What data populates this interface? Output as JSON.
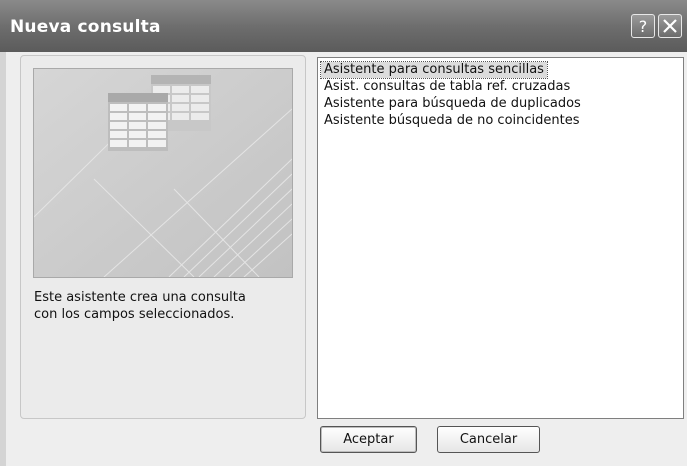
{
  "window": {
    "title": "Nueva consulta",
    "help_label": "?",
    "close_label": "X"
  },
  "preview": {
    "icon": "query-table-illustration-icon",
    "description_line1": "Este asistente crea una consulta",
    "description_line2": "con los campos seleccionados."
  },
  "wizard_list": {
    "items": [
      "Asistente para consultas sencillas",
      "Asist. consultas de tabla ref. cruzadas",
      "Asistente para búsqueda de duplicados",
      "Asistente búsqueda de no coincidentes"
    ],
    "selected_index": 0
  },
  "buttons": {
    "ok_label": "Aceptar",
    "cancel_label": "Cancelar"
  },
  "colors": {
    "titlebar": "#6e6e6e",
    "dialog_bg": "#eeeeee",
    "selection": "#dcdcdc"
  }
}
